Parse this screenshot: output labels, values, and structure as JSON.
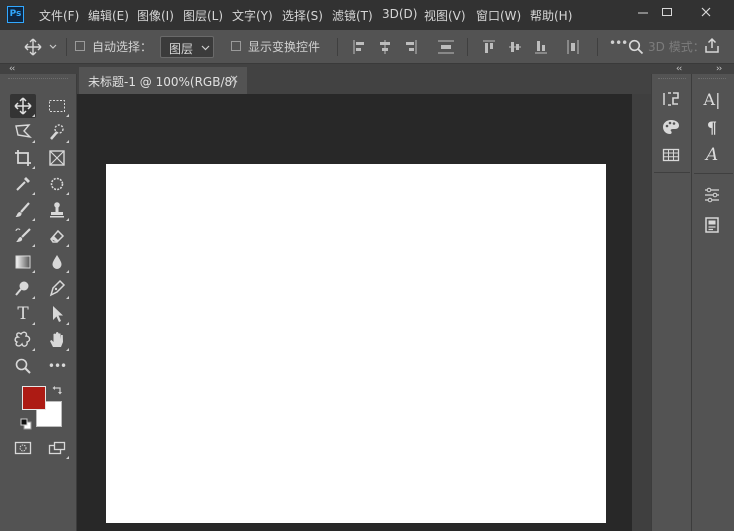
{
  "app": {
    "logo_text": "Ps"
  },
  "menu": [
    {
      "label": "文件(F)"
    },
    {
      "label": "编辑(E)"
    },
    {
      "label": "图像(I)"
    },
    {
      "label": "图层(L)"
    },
    {
      "label": "文字(Y)"
    },
    {
      "label": "选择(S)"
    },
    {
      "label": "滤镜(T)"
    },
    {
      "label": "3D(D)"
    },
    {
      "label": "视图(V)"
    },
    {
      "label": "窗口(W)"
    },
    {
      "label": "帮助(H)"
    }
  ],
  "options_bar": {
    "auto_select_label": "自动选择：",
    "auto_select_checked": false,
    "auto_select_target": "图层",
    "show_transform_label": "显示变换控件",
    "show_transform_checked": false,
    "more_label": "•••",
    "mode_3d_label": "3D 模式："
  },
  "document": {
    "tab_title": "未标题-1 @ 100%(RGB/8)",
    "close_glyph": "×"
  },
  "colors": {
    "foreground": "#ad1b14",
    "background": "#ffffff",
    "canvas": "#ffffff",
    "accent": "#31a8ff"
  },
  "toolbar": {
    "tools": [
      {
        "name": "move-tool",
        "icon": "move-icon",
        "active": true
      },
      {
        "name": "marquee-tool",
        "icon": "rectangle-marquee-icon"
      },
      {
        "name": "lasso-tool",
        "icon": "polygon-lasso-icon"
      },
      {
        "name": "quick-select-tool",
        "icon": "quick-selection-icon"
      },
      {
        "name": "crop-tool",
        "icon": "crop-icon"
      },
      {
        "name": "frame-tool",
        "icon": "frame-icon"
      },
      {
        "name": "eyedropper-tool",
        "icon": "eyedropper-icon"
      },
      {
        "name": "healing-tool",
        "icon": "spot-healing-icon"
      },
      {
        "name": "brush-tool",
        "icon": "brush-icon"
      },
      {
        "name": "stamp-tool",
        "icon": "clone-stamp-icon"
      },
      {
        "name": "history-brush-tool",
        "icon": "history-brush-icon"
      },
      {
        "name": "eraser-tool",
        "icon": "eraser-icon"
      },
      {
        "name": "gradient-tool",
        "icon": "gradient-icon"
      },
      {
        "name": "blur-tool",
        "icon": "blur-drop-icon"
      },
      {
        "name": "dodge-tool",
        "icon": "dodge-icon"
      },
      {
        "name": "pen-tool",
        "icon": "pen-icon"
      },
      {
        "name": "type-tool",
        "icon": "type-icon",
        "glyph": "T"
      },
      {
        "name": "path-select-tool",
        "icon": "arrow-pointer-icon"
      },
      {
        "name": "shape-tool",
        "icon": "custom-shape-icon"
      },
      {
        "name": "hand-tool",
        "icon": "hand-icon"
      },
      {
        "name": "zoom-tool",
        "icon": "magnifier-icon"
      },
      {
        "name": "more-tools",
        "icon": "ellipsis-icon",
        "glyph": "•••"
      }
    ]
  },
  "panels": {
    "col1": [
      "history-icon",
      "swatches-palette-icon",
      "table-grid-icon"
    ],
    "col2": [
      "character-icon",
      "paragraph-icon",
      "glyphs-icon",
      "adjustments-icon",
      "libraries-icon"
    ],
    "col2_glyphs": {
      "character": "A|",
      "paragraph": "¶",
      "glyphs": "A"
    }
  }
}
